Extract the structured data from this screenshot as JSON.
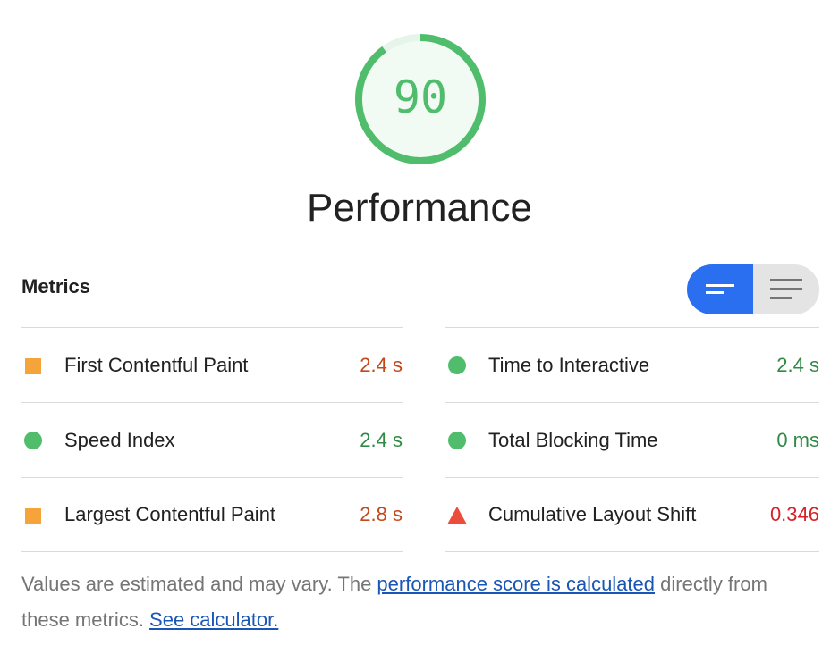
{
  "gauge": {
    "score": "90",
    "title": "Performance",
    "fraction": 0.9,
    "color": "#4fbd6b",
    "track_color": "#e6f5ea"
  },
  "metrics": {
    "header": "Metrics",
    "toggle": {
      "options": [
        "compact-view",
        "expanded-view"
      ],
      "active": "compact-view"
    },
    "left": [
      {
        "label": "First Contentful Paint",
        "value": "2.4 s",
        "status": "average"
      },
      {
        "label": "Speed Index",
        "value": "2.4 s",
        "status": "pass"
      },
      {
        "label": "Largest Contentful Paint",
        "value": "2.8 s",
        "status": "average"
      }
    ],
    "right": [
      {
        "label": "Time to Interactive",
        "value": "2.4 s",
        "status": "pass"
      },
      {
        "label": "Total Blocking Time",
        "value": "0 ms",
        "status": "pass"
      },
      {
        "label": "Cumulative Layout Shift",
        "value": "0.346",
        "status": "fail"
      }
    ]
  },
  "note": {
    "text_1": "Values are estimated and may vary. The ",
    "link_1": "performance score is calculated",
    "text_2": " directly from these metrics. ",
    "link_2": "See calculator."
  },
  "colors": {
    "pass": "#4fbd6b",
    "average": "#f4a43b",
    "fail": "#ec4c3c",
    "toggle_active": "#2a6ff0"
  }
}
